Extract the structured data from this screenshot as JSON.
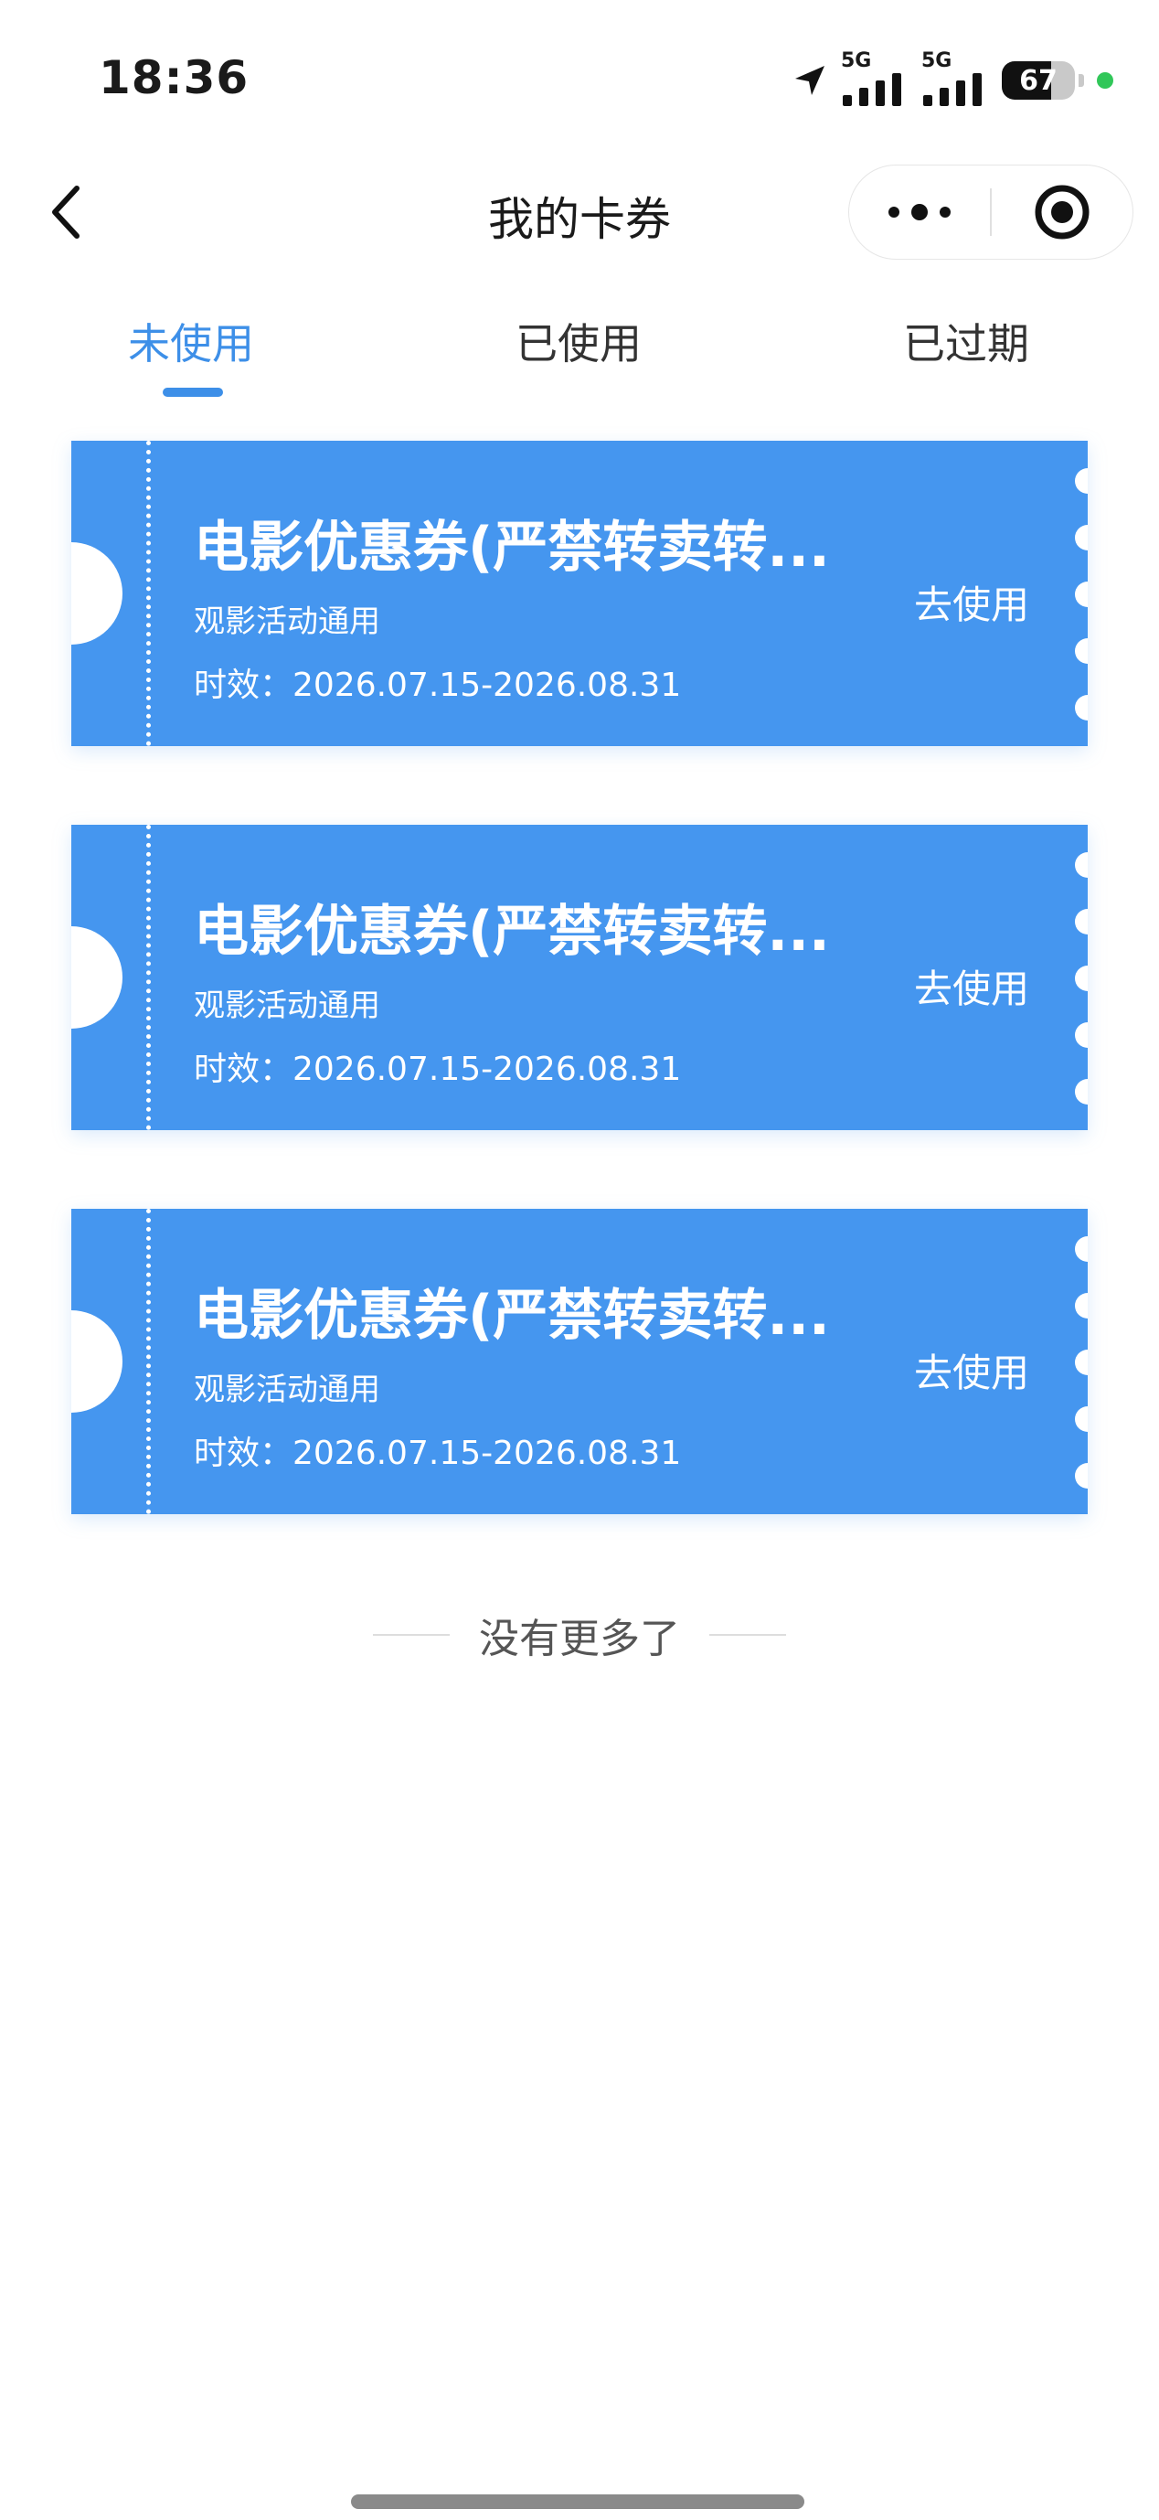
{
  "status_bar": {
    "time": "18:36",
    "network_1": "5G",
    "network_2": "5G",
    "battery_percent": "67",
    "battery_level": 0.67
  },
  "header": {
    "title": "我的卡券",
    "back_icon": "chevron-left-icon",
    "more_icon": "more-dots-icon",
    "close_icon": "target-icon"
  },
  "tabs": [
    {
      "label": "未使用",
      "active": true
    },
    {
      "label": "已使用",
      "active": false
    },
    {
      "label": "已过期",
      "active": false
    }
  ],
  "coupons": [
    {
      "title": "电影优惠券(严禁转卖转...",
      "scope": "观影活动通用",
      "validity": "时效：2026.07.15-2026.08.31",
      "action": "去使用"
    },
    {
      "title": "电影优惠券(严禁转卖转...",
      "scope": "观影活动通用",
      "validity": "时效：2026.07.15-2026.08.31",
      "action": "去使用"
    },
    {
      "title": "电影优惠券(严禁转卖转...",
      "scope": "观影活动通用",
      "validity": "时效：2026.07.15-2026.08.31",
      "action": "去使用"
    }
  ],
  "footer": {
    "no_more_text": "没有更多了"
  },
  "colors": {
    "accent": "#3d8fe8",
    "coupon_bg": "#4596ef",
    "text_primary": "#1a1a1a"
  }
}
